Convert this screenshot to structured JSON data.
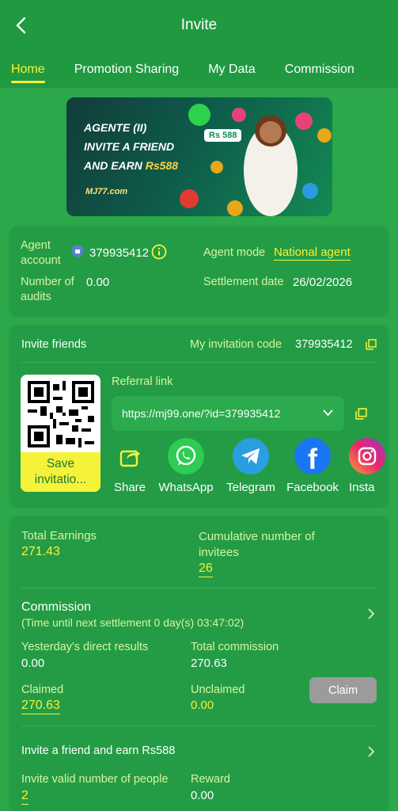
{
  "header": {
    "title": "Invite"
  },
  "tabs": [
    {
      "label": "Home"
    },
    {
      "label": "Promotion Sharing"
    },
    {
      "label": "My Data"
    },
    {
      "label": "Commission"
    }
  ],
  "banner": {
    "line1": "AGENTE (II)",
    "line2": "INVITE A FRIEND",
    "line3_prefix": "AND EARN ",
    "line3_amount": "Rs588",
    "brand": "MJ77.com",
    "bubble": "Rs 588"
  },
  "agent": {
    "account_label": "Agent account",
    "account_value": "379935412",
    "mode_label": "Agent mode",
    "mode_value": "National agent",
    "audits_label": "Number of audits",
    "audits_value": "0.00",
    "settlement_label": "Settlement date",
    "settlement_value": "26/02/2026"
  },
  "invite": {
    "title": "Invite friends",
    "code_label": "My invitation code",
    "code_value": "379935412",
    "save_label": "Save invitatio...",
    "referral_label": "Referral link",
    "referral_url": "https://mj99.one/?id=379935412",
    "share_items": [
      {
        "label": "Share"
      },
      {
        "label": "WhatsApp"
      },
      {
        "label": "Telegram"
      },
      {
        "label": "Facebook"
      },
      {
        "label": "Insta"
      }
    ]
  },
  "stats": {
    "total_earnings_label": "Total Earnings",
    "total_earnings_value": "271.43",
    "cumulative_label": "Cumulative number of invitees",
    "cumulative_value": "26",
    "commission_title": "Commission",
    "commission_sub": "(Time until next settlement 0 day(s) 03:47:02)",
    "yesterday_label": "Yesterday's direct results",
    "yesterday_value": "0.00",
    "total_commission_label": "Total commission",
    "total_commission_value": "270.63",
    "claimed_label": "Claimed",
    "claimed_value": "270.63",
    "unclaimed_label": "Unclaimed",
    "unclaimed_value": "0.00",
    "claim_button": "Claim",
    "invite_earn_title": "Invite a friend and earn Rs588",
    "valid_people_label": "Invite valid number of people",
    "valid_people_value": "2",
    "reward_label": "Reward",
    "reward_value": "0.00"
  },
  "colors": {
    "background": "#2aa84a",
    "header": "#1f9a40",
    "accent_yellow": "#f5f23a",
    "label_green": "#d6f5a0",
    "claim_gray": "#9b9b9b"
  }
}
